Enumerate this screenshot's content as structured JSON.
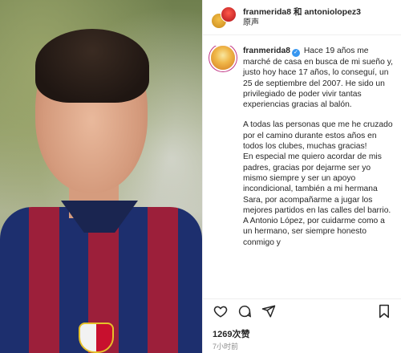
{
  "header": {
    "users": "franmerida8 和 antoniolopez3",
    "audio": "原声"
  },
  "post": {
    "author": "franmerida8",
    "caption_first": "Hace 19 años me marché de casa en busca de mi sueño y, justo hoy hace 17 años, lo conseguí, un 25 de septiembre del 2007. He sido un privilegiado de poder vivir tantas experiencias gracias al balón.",
    "caption_p2": "A todas las personas que me he cruzado por el camino durante estos años en todos los clubes, muchas gracias!",
    "caption_p3": "En especial me quiero acordar de mis padres, gracias por dejarme ser yo mismo siempre y ser un apoyo incondicional, también a mi hermana Sara, por acompañarme a jugar los mejores partidos en las calles del barrio. A Antonio López, por cuidarme como a un hermano, ser siempre honesto conmigo y"
  },
  "stats": {
    "likes": "1269次赞",
    "time": "7小时前"
  },
  "icons": {
    "like": "heart-icon",
    "comment": "comment-icon",
    "share": "send-icon",
    "save": "bookmark-icon"
  }
}
